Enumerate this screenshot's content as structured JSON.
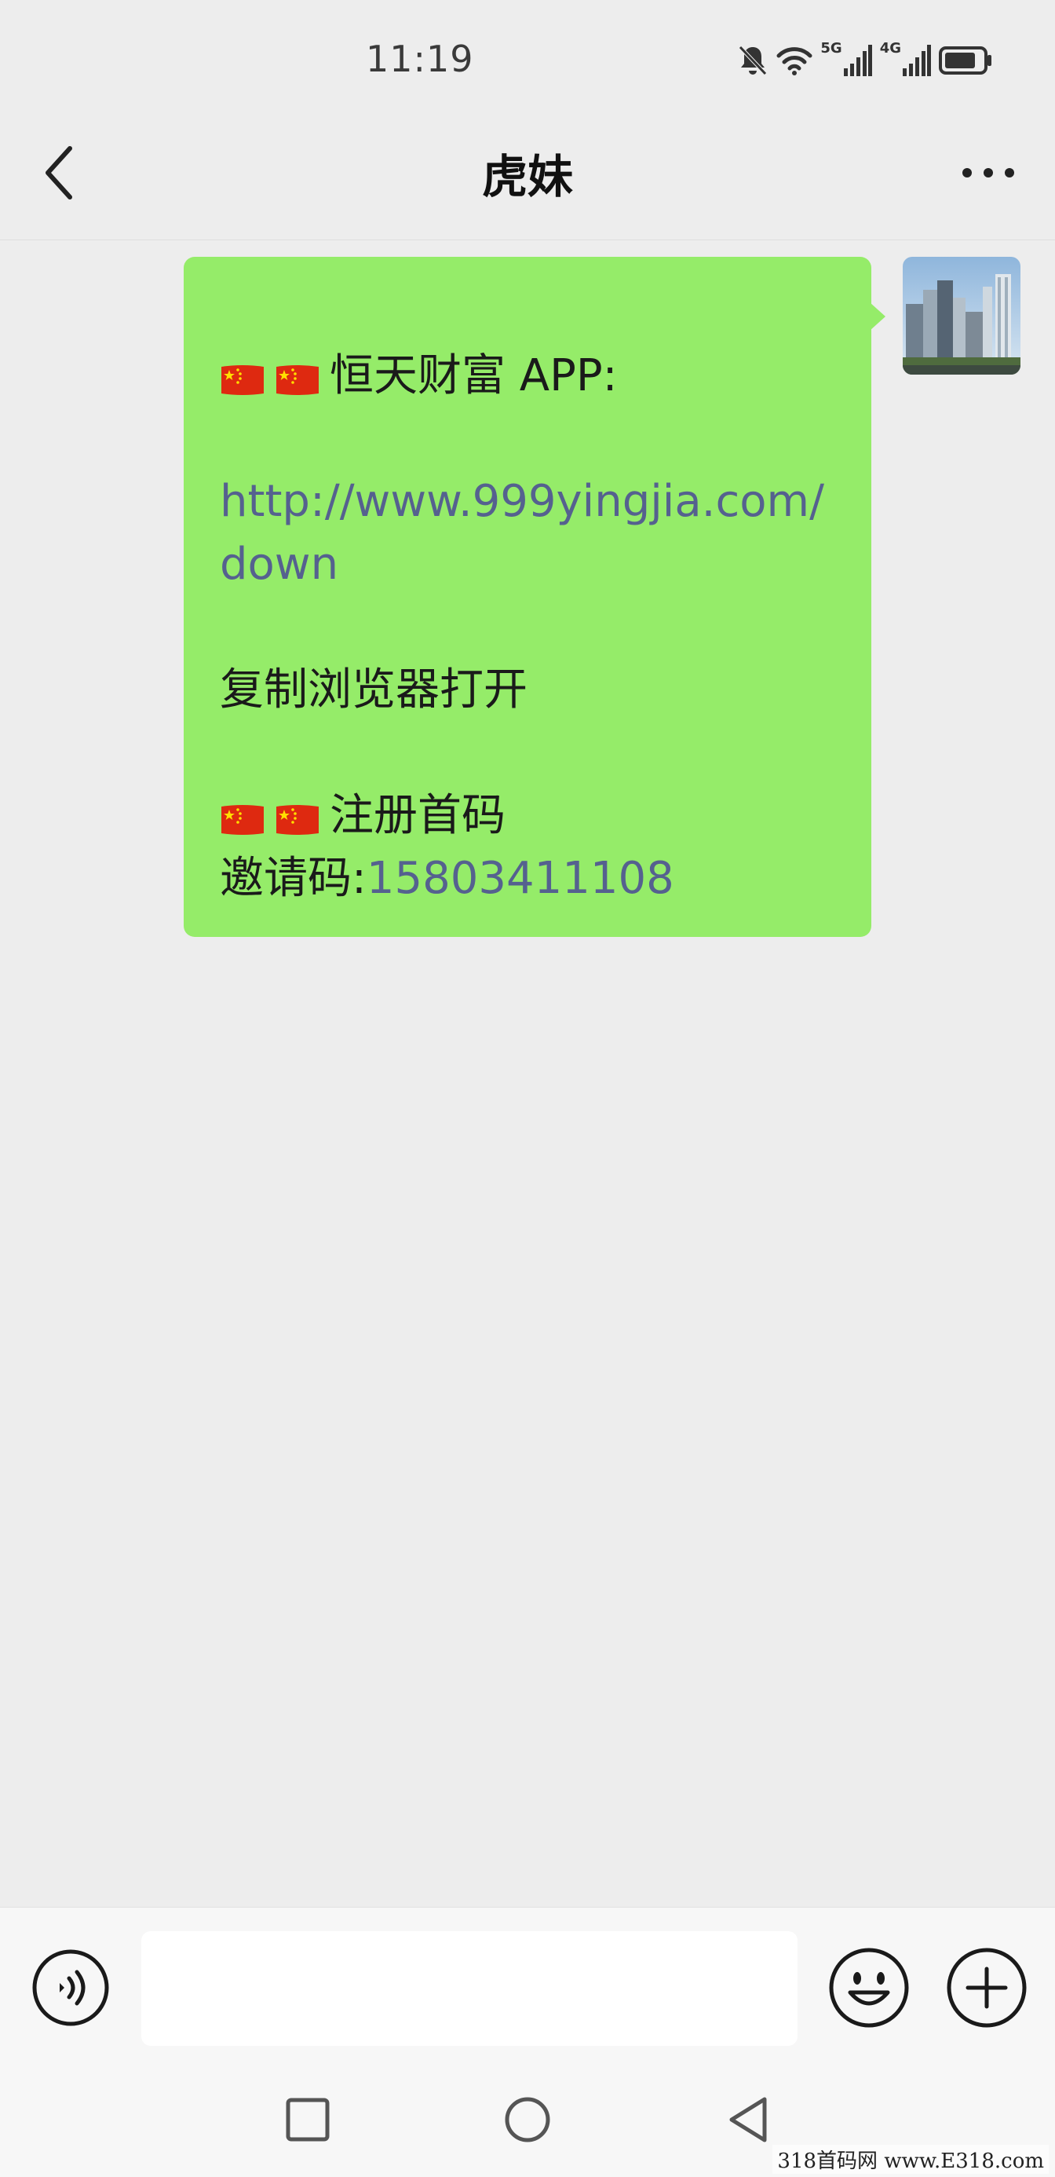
{
  "status_bar": {
    "time": "11:19",
    "icons": [
      "bell-off-icon",
      "wifi-icon",
      "signal-5g-icon",
      "signal-4g-icon",
      "battery-icon"
    ],
    "net1": "5G",
    "net2": "4G"
  },
  "header": {
    "title": "虎妹",
    "back_icon": "chevron-left-icon",
    "more_icon": "more-dots-icon"
  },
  "message": {
    "line1": "恒天财富 APP:",
    "link": "http://www.999yingjia.com/down",
    "line3": "复制浏览器打开",
    "line4": "注册首码",
    "invite_label": "邀请码:",
    "invite_code": "15803411108"
  },
  "input_bar": {
    "placeholder": "",
    "voice_icon": "voice-icon",
    "emoji_icon": "emoji-icon",
    "plus_icon": "plus-circle-icon"
  },
  "system_nav": [
    "square-recents-icon",
    "circle-home-icon",
    "triangle-back-icon"
  ],
  "watermark": "318首码网  www.E318.com",
  "colors": {
    "bubble": "#95ec69",
    "link": "#55618f",
    "background": "#ededed"
  }
}
